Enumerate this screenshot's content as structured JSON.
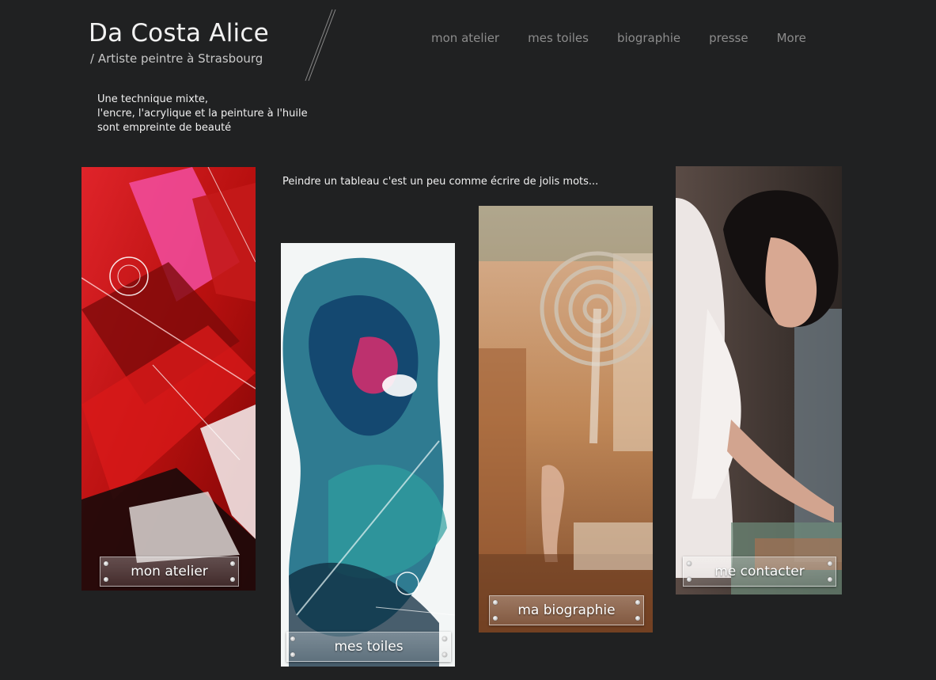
{
  "header": {
    "title": "Da Costa Alice",
    "subtitle": "/ Artiste peintre à Strasbourg"
  },
  "nav": {
    "items": [
      "mon atelier",
      "mes toiles",
      "biographie",
      "presse",
      "More"
    ]
  },
  "tagline": {
    "lines": [
      "Une technique mixte,",
      "l'encre, l'acrylique et la peinture à l'huile",
      "sont empreinte de beauté"
    ]
  },
  "quote": "Peindre un tableau c'est un peu comme écrire de jolis mots...",
  "cards": [
    {
      "label": "mon atelier"
    },
    {
      "label": "mes toiles"
    },
    {
      "label": "ma biographie"
    },
    {
      "label": "me contacter"
    }
  ],
  "colors": {
    "background": "#202122",
    "nav_text": "#8c8c8c",
    "title_text": "#f2f2f2",
    "painting_red": "#c41414",
    "painting_teal": "#1f7f8f",
    "painting_ochre": "#b07a4a"
  }
}
